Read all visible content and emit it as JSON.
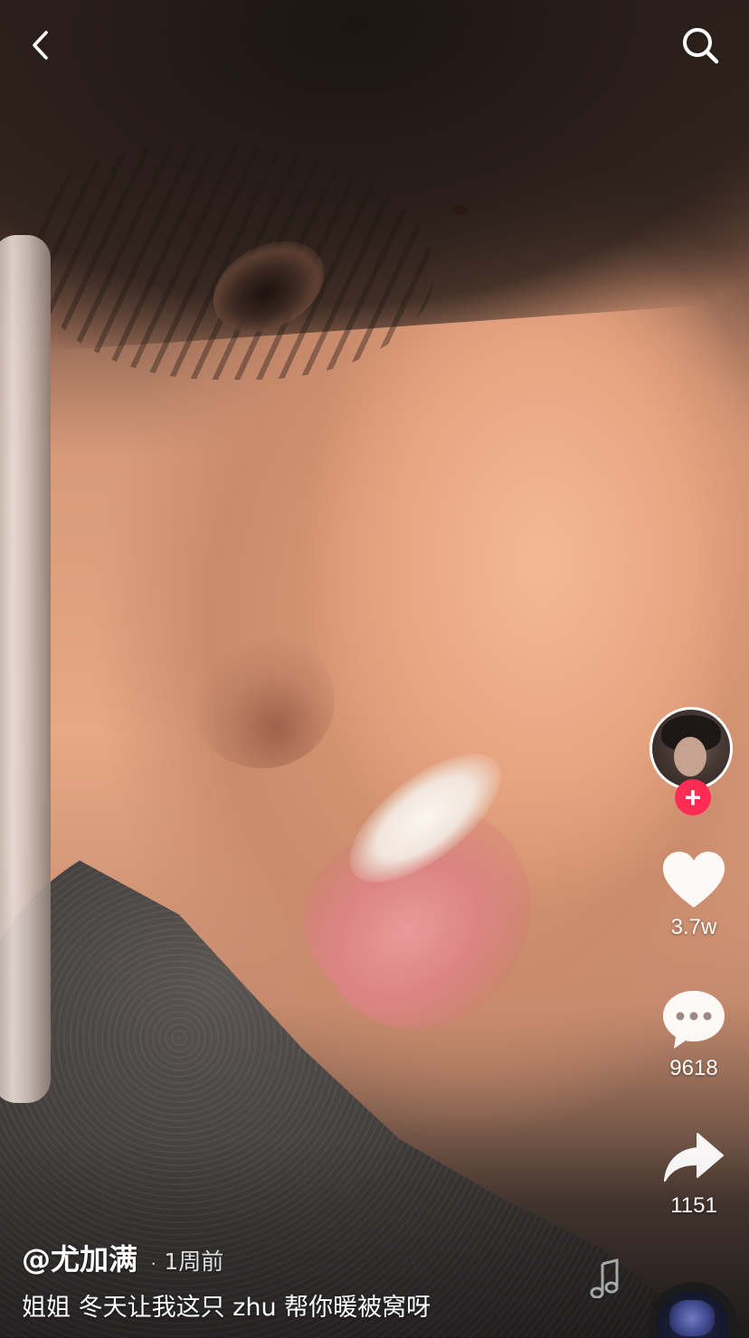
{
  "post": {
    "author": "@尤加满",
    "time": "1周前",
    "caption": "姐姐 冬天让我这只 zhu 帮你暖被窝呀"
  },
  "actions": {
    "likes": "3.7w",
    "comments": "9618",
    "shares": "1151"
  },
  "icons": {
    "back": "chevron-left-icon",
    "search": "search-icon",
    "follow": "plus-icon",
    "like": "heart-icon",
    "comment": "comment-bubble-icon",
    "share": "share-arrow-icon",
    "music": "music-note-icon"
  },
  "colors": {
    "follow_accent": "#fe2c55",
    "icon_white": "#ffffff"
  },
  "symbols": {
    "follow_plus": "+",
    "separator": "·"
  }
}
